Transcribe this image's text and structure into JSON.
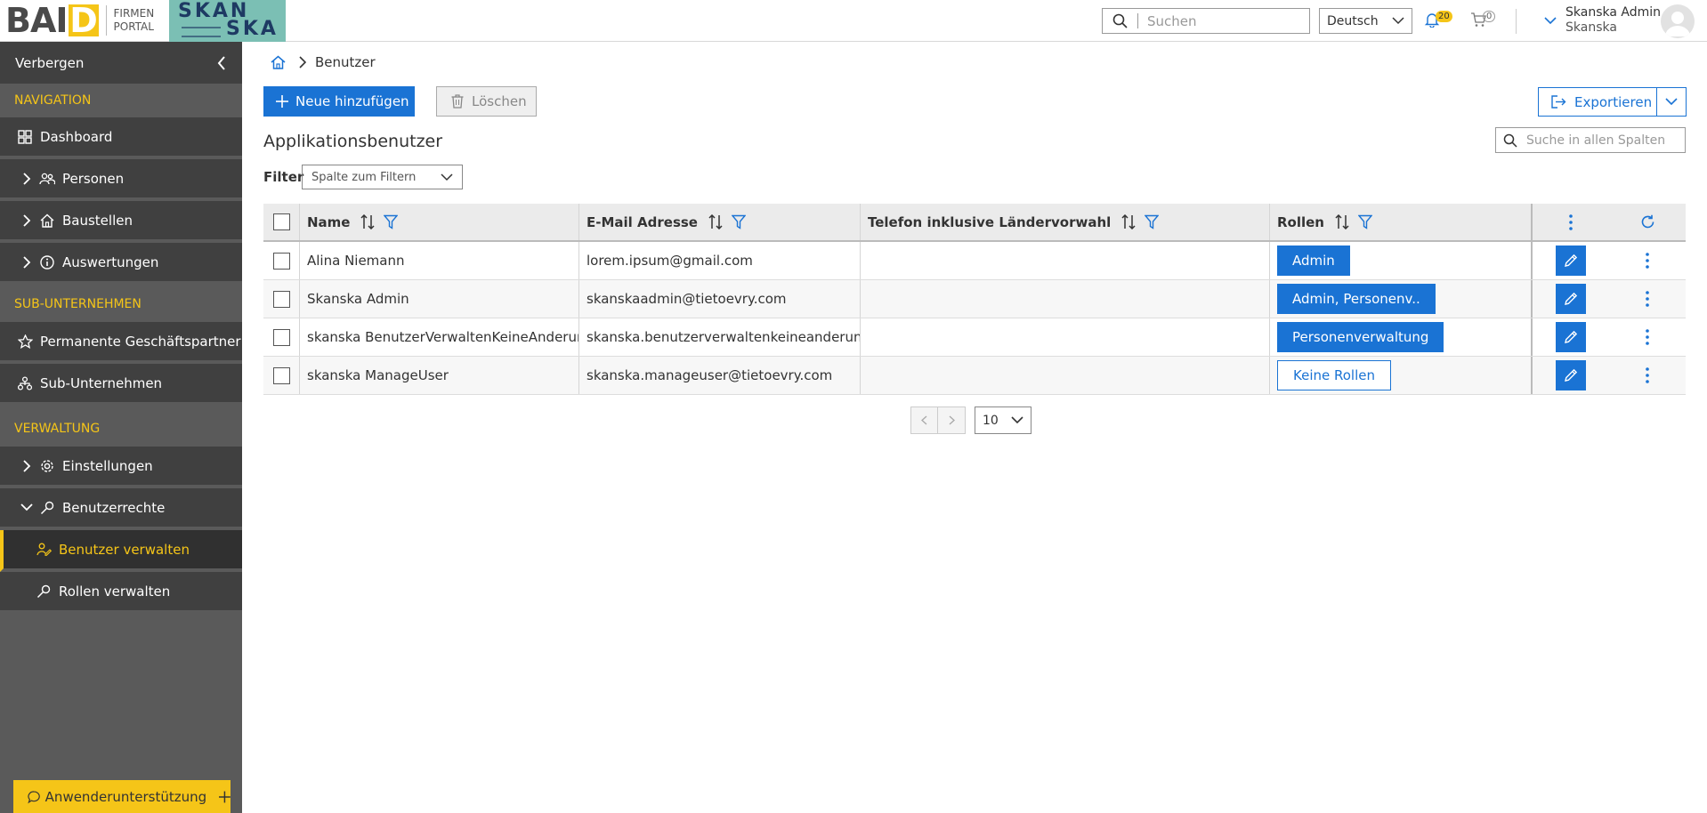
{
  "header": {
    "brand_main": "BAI",
    "brand_d": "D",
    "brand_sub1": "FIRMEN",
    "brand_sub2": "PORTAL",
    "partner_logo_line1": "SKAN",
    "partner_logo_line2": "SKA",
    "search_placeholder": "Suchen",
    "language": "Deutsch",
    "notifications_count": "20",
    "cart_count": "0",
    "user_name": "Skanska Admin",
    "user_company": "Skanska"
  },
  "sidebar": {
    "hide_label": "Verbergen",
    "sections": {
      "navigation": "NAVIGATION",
      "sub_companies": "SUB-UNTERNEHMEN",
      "administration": "VERWALTUNG"
    },
    "items": {
      "dashboard": "Dashboard",
      "persons": "Personen",
      "sites": "Baustellen",
      "reports": "Auswertungen",
      "partners": "Permanente Geschäftspartner",
      "subcompanies": "Sub-Unternehmen",
      "settings": "Einstellungen",
      "user_rights": "Benutzerrechte",
      "manage_users": "Benutzer verwalten",
      "manage_roles": "Rollen verwalten"
    },
    "support_label": "Anwenderunterstützung"
  },
  "main": {
    "breadcrumb_current": "Benutzer",
    "add_button": "Neue hinzufügen",
    "delete_button": "Löschen",
    "export_button": "Exportieren",
    "title": "Applikationsbenutzer",
    "table_search_placeholder": "Suche in allen Spalten",
    "filter_label": "Filter",
    "filter_placeholder": "Spalte zum Filtern"
  },
  "table": {
    "columns": {
      "name": "Name",
      "email": "E-Mail Adresse",
      "phone": "Telefon inklusive Ländervorwahl",
      "roles": "Rollen"
    },
    "rows": [
      {
        "name": "Alina Niemann",
        "email": "lorem.ipsum@gmail.com",
        "phone": "",
        "roles": "Admin",
        "outline": false
      },
      {
        "name": "Skanska Admin",
        "email": "skanskaadmin@tietoevry.com",
        "phone": "",
        "roles": "Admin, Personenv..",
        "outline": false
      },
      {
        "name": "skanska BenutzerVerwaltenKeineAnderung",
        "email": "skanska.benutzerverwaltenkeineanderung@tietoevry.com",
        "phone": "",
        "roles": "Personenverwaltung",
        "outline": false
      },
      {
        "name": "skanska ManageUser",
        "email": "skanska.manageuser@tietoevry.com",
        "phone": "",
        "roles": "Keine Rollen",
        "outline": true
      }
    ]
  },
  "pager": {
    "page_size": "10"
  },
  "colors": {
    "accent": "#1a73d4",
    "brand_yellow": "#f5c518",
    "sidebar_bg": "#404040"
  }
}
